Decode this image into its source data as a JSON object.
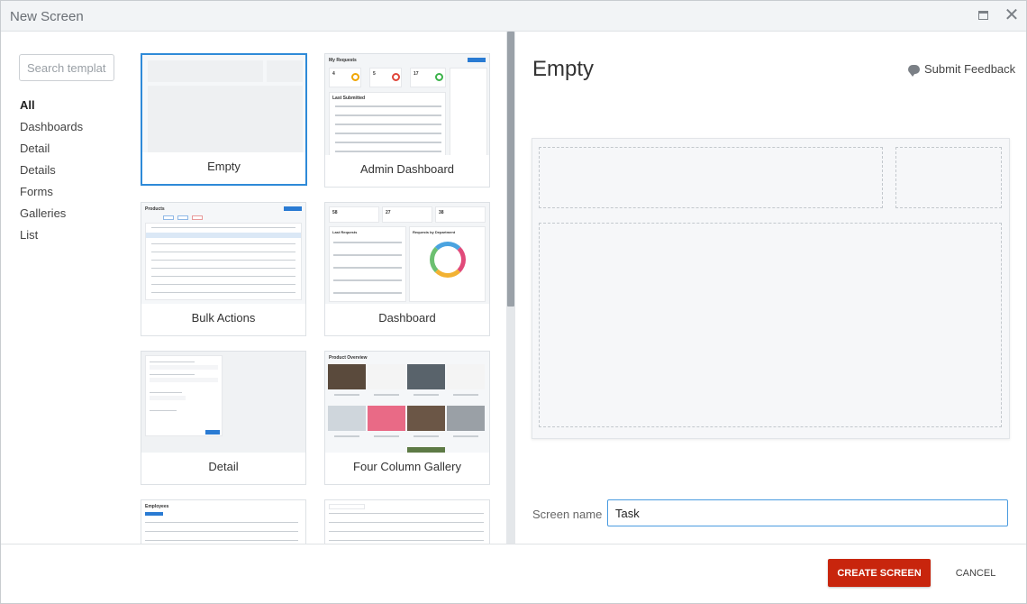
{
  "window": {
    "title": "New Screen",
    "maximize_icon": "maximize-icon",
    "close_icon": "close-icon"
  },
  "sidebar": {
    "search_placeholder": "Search templates",
    "categories": [
      {
        "label": "All",
        "active": true
      },
      {
        "label": "Dashboards"
      },
      {
        "label": "Detail"
      },
      {
        "label": "Details"
      },
      {
        "label": "Forms"
      },
      {
        "label": "Galleries"
      },
      {
        "label": "List"
      }
    ]
  },
  "templates": [
    {
      "label": "Empty",
      "selected": true
    },
    {
      "label": "Admin Dashboard",
      "heading": "My Requests",
      "stats": [
        "4",
        "5",
        "17"
      ],
      "section": "Last Submitted"
    },
    {
      "label": "Bulk Actions",
      "heading": "Products"
    },
    {
      "label": "Dashboard",
      "stats": [
        "58",
        "27",
        "38"
      ],
      "section": "Last Requests",
      "section2": "Requests by Department"
    },
    {
      "label": "Detail"
    },
    {
      "label": "Four Column Gallery",
      "heading": "Product Overview"
    },
    {
      "label": "",
      "heading": "Employees"
    },
    {
      "label": ""
    }
  ],
  "preview": {
    "title": "Empty",
    "feedback_label": "Submit Feedback",
    "feedback_icon": "speech-bubble-icon"
  },
  "form": {
    "screen_name_label": "Screen name",
    "screen_name_value": "Task"
  },
  "footer": {
    "create_label": "CREATE SCREEN",
    "cancel_label": "CANCEL"
  },
  "colors": {
    "accent": "#2e8ad8",
    "primary_button": "#c8250d",
    "titlebar": "#f2f4f6"
  }
}
